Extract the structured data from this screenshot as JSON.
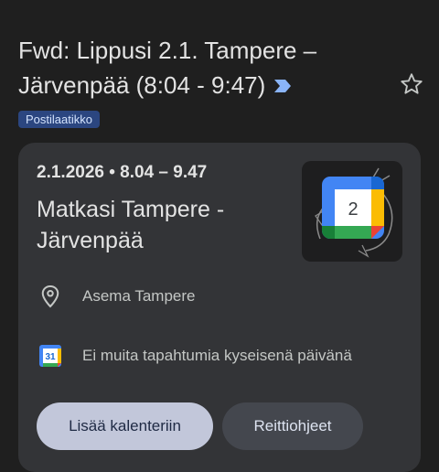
{
  "email": {
    "subject": "Fwd: Lippusi 2.1. Tampere – Järvenpää (8:04 - 9:47)",
    "label": "Postilaatikko",
    "icons": {
      "importance": "importance-marker-icon",
      "star": "star-outline-icon"
    }
  },
  "event_card": {
    "date": "2.1.2026 • 8.04 – 9.47",
    "title": "Matkasi Tampere - Järvenpää",
    "thumbnail": {
      "icon": "google-calendar-icon",
      "day": "2"
    },
    "location": {
      "icon": "location-pin-icon",
      "text": "Asema Tampere"
    },
    "calendar": {
      "icon": "calendar-31-icon",
      "day": "31",
      "text": "Ei muita tapahtumia kyseisenä päivänä"
    },
    "buttons": {
      "add_to_calendar": "Lisää kalenteriin",
      "directions": "Reittiohjeet"
    }
  },
  "colors": {
    "background": "#1f1f1f",
    "card": "#333437",
    "label_chip": "#2b4680",
    "primary_button": "#c2c7da",
    "secondary_button": "#44474e",
    "importance": "#8ab4f8"
  }
}
